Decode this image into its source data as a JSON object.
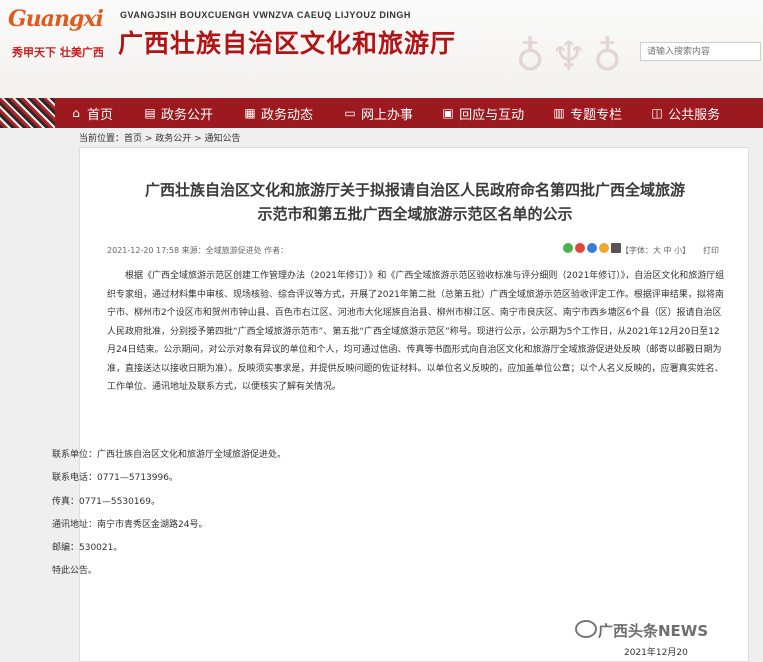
{
  "header": {
    "logo_word": "Guangxi",
    "slogan": "秀甲天下 壮美广西",
    "site_en": "GVANGJSIH BOUXCUENGH VWNZVA CAEUQ LIJYOUZ DINGH",
    "site_cn": "广西壮族自治区文化和旅游厅",
    "search_placeholder": "请输入搜索内容"
  },
  "nav": [
    {
      "label": "首页",
      "icon": "home-icon"
    },
    {
      "label": "政务公开",
      "icon": "document-icon"
    },
    {
      "label": "政务动态",
      "icon": "news-icon"
    },
    {
      "label": "网上办事",
      "icon": "computer-icon"
    },
    {
      "label": "回应与互动",
      "icon": "chat-icon"
    },
    {
      "label": "专题专栏",
      "icon": "folder-icon"
    },
    {
      "label": "公共服务",
      "icon": "service-icon"
    }
  ],
  "breadcrumb": "当前位置：首页 > 政务公开 > 通知公告",
  "article": {
    "title_line1": "广西壮族自治区文化和旅游厅关于拟报请自治区人民政府命名第四批广西全域旅游",
    "title_line2": "示范市和第五批广西全域旅游示范区名单的公示",
    "meta": "2021-12-20 17:58    来源：全域旅游促进处    作者：",
    "font_size": "【字体：大 中 小】",
    "print": "打印",
    "body": "根据《广西全域旅游示范区创建工作管理办法（2021年修订）》和《广西全域旅游示范区验收标准与评分细则（2021年修订）》，自治区文化和旅游厅组织专家组，通过材料集中审核、现场核验、综合评议等方式，开展了2021年第二批（总第五批）广西全域旅游示范区验收评定工作。根据评审结果，拟将南宁市、柳州市2个设区市和贺州市钟山县、百色市右江区、河池市大化瑶族自治县、柳州市柳江区、南宁市良庆区、南宁市西乡塘区6个县（区）报请自治区人民政府批准，分别授予第四批“广西全域旅游示范市”、第五批“广西全域旅游示范区”称号。现进行公示，公示期为5个工作日，从2021年12月20日至12月24日结束。公示期间，对公示对象有异议的单位和个人，均可通过信函、传真等书面形式向自治区文化和旅游厅全域旅游促进处反映（邮寄以邮戳日期为准，直接送达以接收日期为准）。反映须实事求是，并提供反映问题的佐证材料。以单位名义反映的，应加盖单位公章；以个人名义反映的，应署真实姓名、工作单位、通讯地址及联系方式，以便核实了解有关情况。",
    "contacts": [
      "联系单位：广西壮族自治区文化和旅游厅全域旅游促进处。",
      "联系电话：0771—5713996。",
      "传真：0771—5530169。",
      "通讯地址：南宁市青秀区金湖路24号。",
      "邮编：530021。",
      "特此公告。"
    ],
    "watermark": "广西头条NEWS",
    "footer_date": "2021年12月20"
  }
}
